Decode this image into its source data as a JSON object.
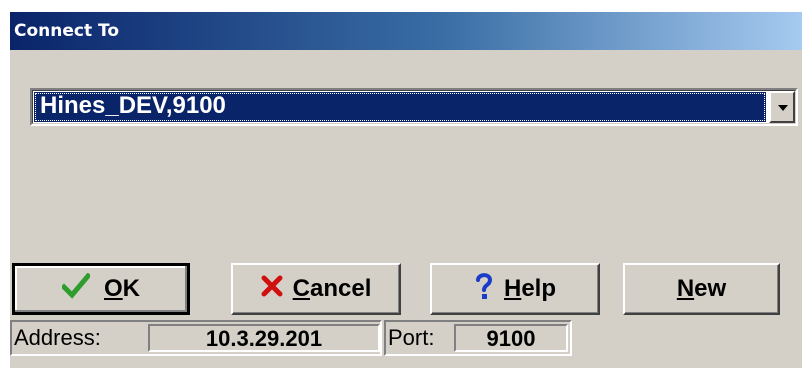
{
  "dialog": {
    "title": "Connect To"
  },
  "connection_select": {
    "value": "Hines_DEV,9100"
  },
  "buttons": {
    "ok": {
      "label_pre": "",
      "mnemonic": "O",
      "label_post": "K",
      "icon": "checkmark-icon",
      "icon_color": "#2e9d2e"
    },
    "cancel": {
      "label_pre": "",
      "mnemonic": "C",
      "label_post": "ancel",
      "icon": "red-x-icon",
      "icon_color": "#d01010"
    },
    "help": {
      "label_pre": "",
      "mnemonic": "H",
      "label_post": "elp",
      "icon": "question-mark-icon",
      "icon_color": "#1a3cc8"
    },
    "new": {
      "label_pre": "",
      "mnemonic": "N",
      "label_post": "ew"
    }
  },
  "status": {
    "address_label": "Address:",
    "address_value": "10.3.29.201",
    "port_label": "Port:",
    "port_value": "9100"
  },
  "colors": {
    "title_gradient_start": "#0a246a",
    "title_gradient_end": "#a6caf0",
    "face": "#d4d0c8",
    "selection": "#0a246a"
  }
}
